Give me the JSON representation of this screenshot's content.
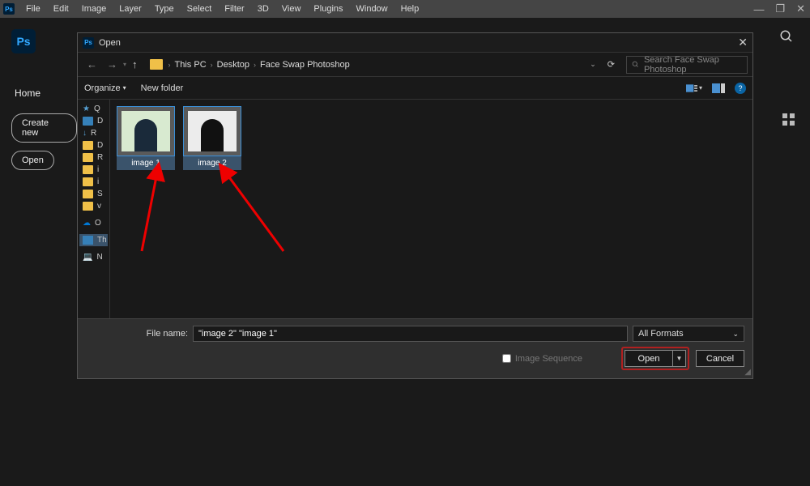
{
  "menubar": {
    "items": [
      "File",
      "Edit",
      "Image",
      "Layer",
      "Type",
      "Select",
      "Filter",
      "3D",
      "View",
      "Plugins",
      "Window",
      "Help"
    ]
  },
  "leftRail": {
    "home": "Home",
    "createNew": "Create new",
    "open": "Open"
  },
  "dialog": {
    "title": "Open",
    "breadcrumb": [
      "This PC",
      "Desktop",
      "Face Swap Photoshop"
    ],
    "searchPlaceholder": "Search Face Swap Photoshop",
    "organize": "Organize",
    "newFolder": "New folder",
    "sidebar": {
      "quickAccess": "Q",
      "items": [
        "D",
        "R",
        "D",
        "R",
        "i",
        "i",
        "S",
        "v"
      ],
      "onedrive": "O",
      "thispc": "Th",
      "network": "N"
    },
    "files": [
      {
        "label": "image 1"
      },
      {
        "label": "image 2"
      }
    ],
    "footer": {
      "fileNameLabel": "File name:",
      "fileNameValue": "\"image 2\" \"image 1\"",
      "format": "All Formats",
      "imageSequence": "Image Sequence",
      "open": "Open",
      "cancel": "Cancel"
    }
  }
}
